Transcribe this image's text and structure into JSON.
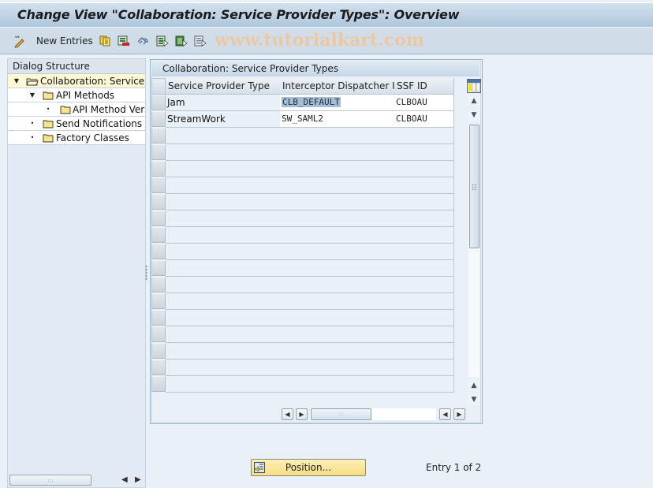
{
  "window": {
    "title": "Change View \"Collaboration: Service Provider Types\": Overview"
  },
  "toolbar": {
    "items": [
      {
        "icon": "edit-pencil-icon",
        "label": ""
      },
      {
        "icon": "",
        "label": "New Entries"
      },
      {
        "icon": "copy-icon",
        "label": ""
      },
      {
        "icon": "delete-icon",
        "label": ""
      },
      {
        "icon": "undo-icon",
        "label": ""
      },
      {
        "icon": "select-all-icon",
        "label": ""
      },
      {
        "icon": "select-block-icon",
        "label": ""
      },
      {
        "icon": "deselect-all-icon",
        "label": ""
      }
    ],
    "watermark": "www.tutorialkart.com"
  },
  "dialog_structure": {
    "header": "Dialog Structure",
    "items": [
      {
        "label": "Collaboration: Service Provider Types",
        "level": 0,
        "expanded": true,
        "selected": true,
        "open_folder": true
      },
      {
        "label": "API Methods",
        "level": 1,
        "expanded": true,
        "selected": false
      },
      {
        "label": "API Method Versions",
        "level": 2,
        "expanded": false,
        "selected": false
      },
      {
        "label": "Send Notifications",
        "level": 1,
        "expanded": false,
        "selected": false
      },
      {
        "label": "Factory Classes",
        "level": 1,
        "expanded": false,
        "selected": false
      }
    ]
  },
  "table": {
    "title": "Collaboration: Service Provider Types",
    "columns": [
      "Service Provider Type",
      "Interceptor Dispatcher ID",
      "SSF ID"
    ],
    "rows": [
      [
        "Jam",
        "CLB_DEFAULT",
        "CLBOAU"
      ],
      [
        "StreamWork",
        "SW_SAML2",
        "CLBOAU"
      ]
    ],
    "empty_rows": 17,
    "highlighted_cell": {
      "row": 0,
      "col": 1
    }
  },
  "footer": {
    "position_button": "Position...",
    "entry_info": "Entry 1 of 2"
  }
}
